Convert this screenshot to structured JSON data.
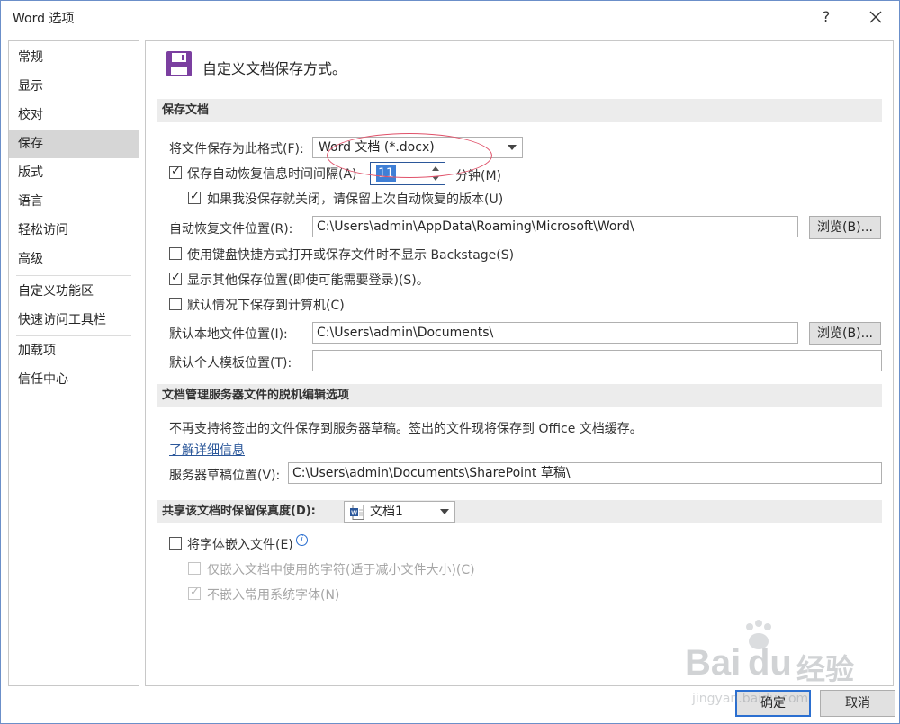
{
  "window": {
    "title": "Word 选项",
    "help": "?"
  },
  "sidebar": {
    "items": [
      {
        "label": "常规"
      },
      {
        "label": "显示"
      },
      {
        "label": "校对"
      },
      {
        "label": "保存"
      },
      {
        "label": "版式"
      },
      {
        "label": "语言"
      },
      {
        "label": "轻松访问"
      },
      {
        "label": "高级"
      },
      {
        "label": "自定义功能区"
      },
      {
        "label": "快速访问工具栏"
      },
      {
        "label": "加载项"
      },
      {
        "label": "信任中心"
      }
    ]
  },
  "header": {
    "title": "自定义文档保存方式。"
  },
  "save": {
    "section_title": "保存文档",
    "format_label": "将文件保存为此格式(F):",
    "format_value": "Word 文档 (*.docx)",
    "autorecover_label": "保存自动恢复信息时间间隔(A)",
    "autorecover_checked": true,
    "autorecover_value": "11",
    "minutes_label": "分钟(M)",
    "keep_last_label": "如果我没保存就关闭，请保留上次自动恢复的版本(U)",
    "autorecover_location_label": "自动恢复文件位置(R):",
    "autorecover_location_value": "C:\\Users\\admin\\AppData\\Roaming\\Microsoft\\Word\\",
    "browse_label": "浏览(B)...",
    "no_backstage_label": "使用键盘快捷方式打开或保存文件时不显示 Backstage(S)",
    "show_other_label": "显示其他保存位置(即使可能需要登录)(S)。",
    "save_to_computer_label": "默认情况下保存到计算机(C)",
    "default_local_label": "默认本地文件位置(I):",
    "default_local_value": "C:\\Users\\admin\\Documents\\",
    "template_location_label": "默认个人模板位置(T):",
    "template_location_value": ""
  },
  "offline": {
    "section_title": "文档管理服务器文件的脱机编辑选项",
    "notice": "不再支持将签出的文件保存到服务器草稿。签出的文件现将保存到 Office 文档缓存。",
    "learn_more": "了解详细信息",
    "drafts_label": "服务器草稿位置(V):",
    "drafts_value": "C:\\Users\\admin\\Documents\\SharePoint 草稿\\"
  },
  "fidelity": {
    "section_title": "共享该文档时保留保真度(D):",
    "document_value": "文档1",
    "embed_fonts_label": "将字体嵌入文件(E)",
    "embed_used_label": "仅嵌入文档中使用的字符(适于减小文件大小)(C)",
    "no_common_label": "不嵌入常用系统字体(N)"
  },
  "footer": {
    "ok": "确定",
    "cancel": "取消"
  },
  "watermark": {
    "line1": "Bai",
    "line2": "du",
    "line3": "经验",
    "url": "jingyan.baidu.com"
  },
  "colors": {
    "accent": "#2b579a",
    "selected_nav": "#d6d6d6",
    "save_icon": "#7b3fa0",
    "annotation": "#e0526a"
  }
}
